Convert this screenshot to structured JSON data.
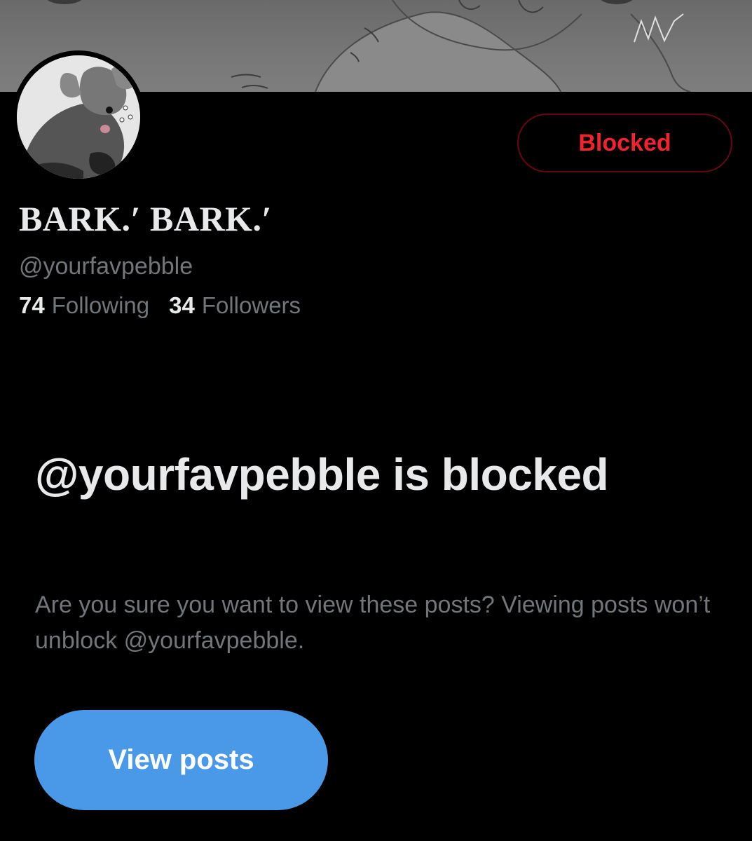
{
  "profile": {
    "display_name": "BARK.′ BARK.′",
    "handle": "@yourfavpebble",
    "following_count": "74",
    "following_label": "Following",
    "followers_count": "34",
    "followers_label": "Followers"
  },
  "actions": {
    "blocked_label": "Blocked",
    "view_posts_label": "View posts"
  },
  "blocked_notice": {
    "title": "@yourfavpebble is blocked",
    "description": "Are you sure you want to view these posts? Viewing posts won’t unblock @yourfavpebble."
  },
  "colors": {
    "background": "#000000",
    "primary_text": "#e7e9ea",
    "secondary_text": "#71767b",
    "blocked_red": "#f4212e",
    "accent_blue": "#4a99e9"
  }
}
